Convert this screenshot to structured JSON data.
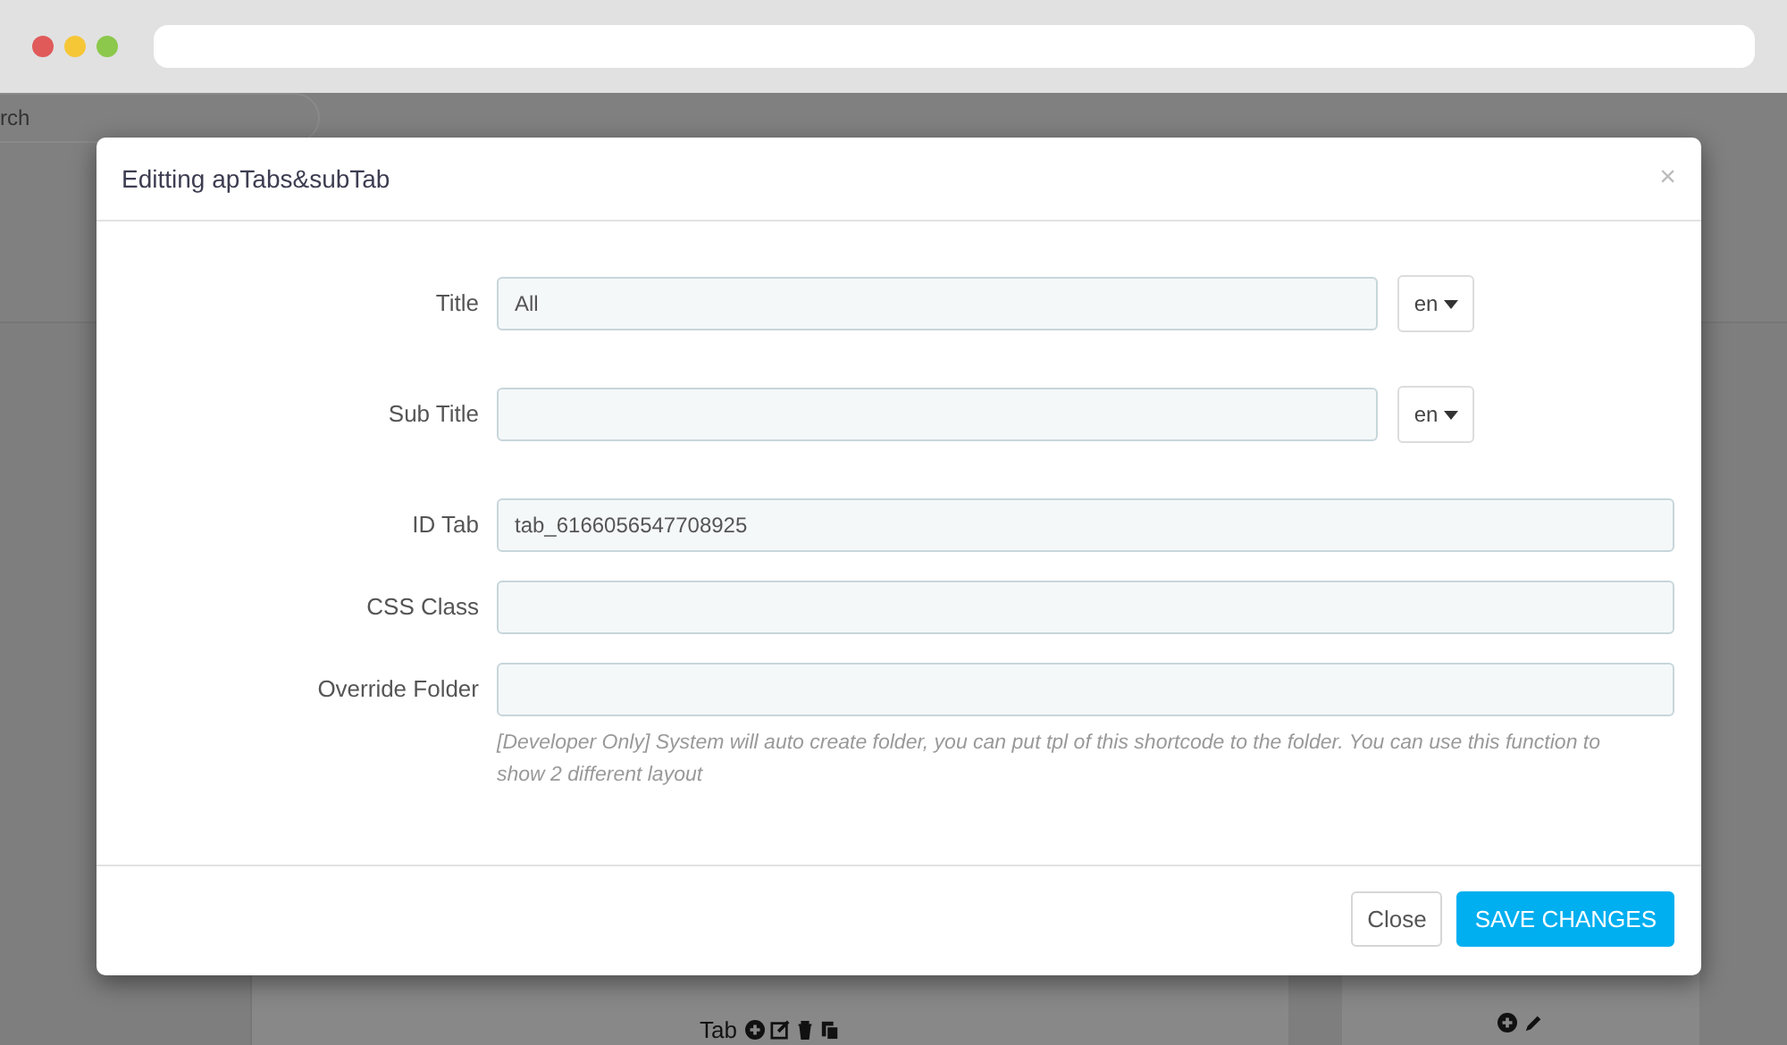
{
  "browser": {
    "window_controls": [
      {
        "color": "#e05a5a"
      },
      {
        "color": "#f5c636"
      },
      {
        "color": "#8cc84b"
      }
    ]
  },
  "background": {
    "search_fragment": "rch",
    "tab_label": "Tab"
  },
  "modal": {
    "title": "Editting apTabs&subTab",
    "close": "×",
    "fields": [
      {
        "label": "Title",
        "value": "All",
        "lang": "en"
      },
      {
        "label": "Sub Title",
        "lang": "en"
      },
      {
        "label": "ID Tab",
        "value": "tab_6166056547708925"
      },
      {
        "label": "CSS Class"
      },
      {
        "label": "Override Folder",
        "help": "[Developer Only] System will auto create folder, you can put tpl of this shortcode to the folder. You can use this function to show 2 different layout"
      }
    ],
    "buttons": [
      {
        "label": "Close",
        "kind": "default"
      },
      {
        "label": "SAVE CHANGES",
        "kind": "primary"
      }
    ]
  }
}
